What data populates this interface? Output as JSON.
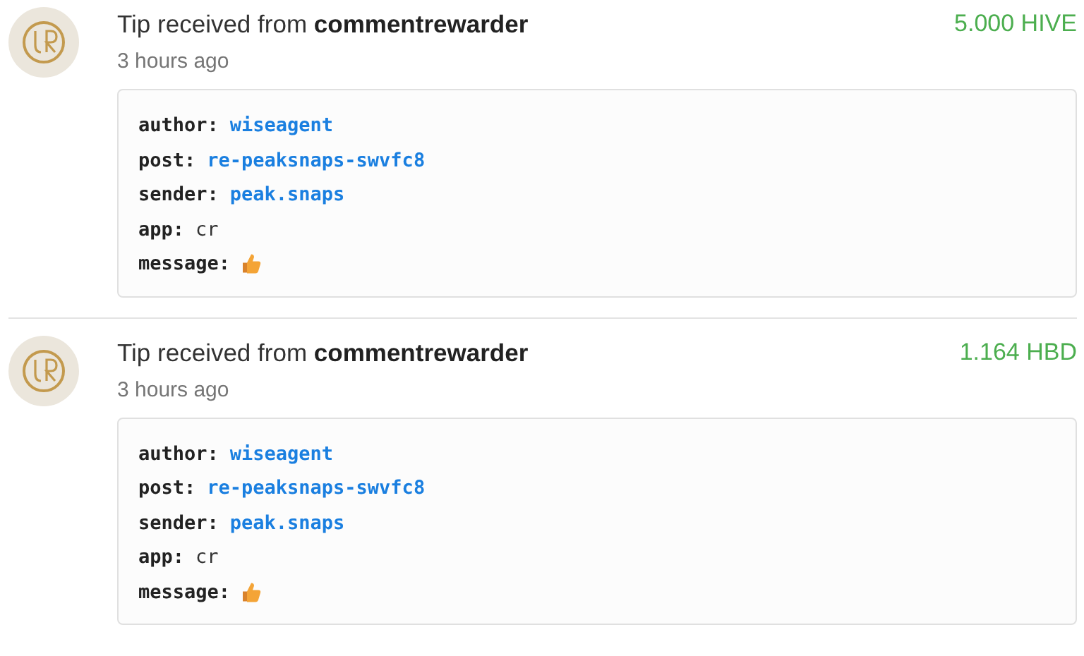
{
  "notifications": [
    {
      "title": "Tip received from **commentrewarder**",
      "time": "3 hours ago",
      "amount": "5.000 HIVE",
      "details": [
        {
          "label": "author:",
          "kind": "link",
          "value": "wiseagent"
        },
        {
          "label": "post:",
          "kind": "link",
          "value": "re-peaksnaps-swvfc8"
        },
        {
          "label": "sender:",
          "kind": "link",
          "value": "peak.snaps"
        },
        {
          "label": "app:",
          "kind": "text",
          "value": "cr"
        },
        {
          "label": "message:",
          "kind": "thumbs-up"
        }
      ]
    },
    {
      "title": "Tip received from **commentrewarder**",
      "time": "3 hours ago",
      "amount": "1.164 HBD",
      "details": [
        {
          "label": "author:",
          "kind": "link",
          "value": "wiseagent"
        },
        {
          "label": "post:",
          "kind": "link",
          "value": "re-peaksnaps-swvfc8"
        },
        {
          "label": "sender:",
          "kind": "link",
          "value": "peak.snaps"
        },
        {
          "label": "app:",
          "kind": "text",
          "value": "cr"
        },
        {
          "label": "message:",
          "kind": "thumbs-up"
        }
      ]
    }
  ]
}
